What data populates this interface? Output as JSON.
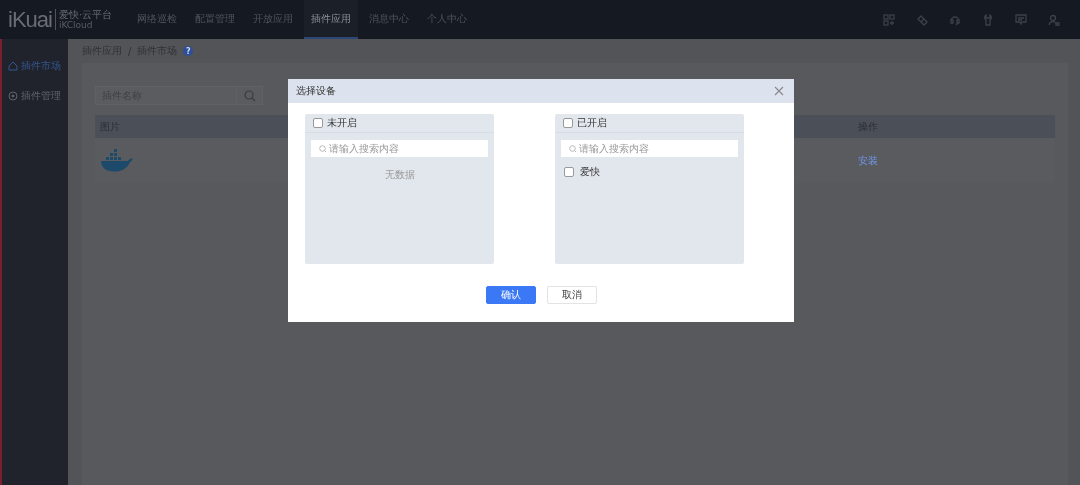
{
  "topbar": {
    "logo": "iKuai",
    "brand_name": "爱快·云平台",
    "brand_sub": "iKCloud",
    "nav": [
      {
        "label": "网络巡检",
        "selected": false
      },
      {
        "label": "配置管理",
        "selected": false
      },
      {
        "label": "开放应用",
        "selected": false
      },
      {
        "label": "插件应用",
        "selected": true
      },
      {
        "label": "消息中心",
        "selected": false
      },
      {
        "label": "个人中心",
        "selected": false
      }
    ]
  },
  "sidebar": {
    "items": [
      {
        "label": "插件市场",
        "selected": true
      },
      {
        "label": "插件管理",
        "selected": false
      }
    ]
  },
  "breadcrumb": {
    "items": [
      "插件应用",
      "插件市场"
    ],
    "separator": "/",
    "help": "?"
  },
  "search": {
    "placeholder": "插件名称"
  },
  "table": {
    "columns": [
      "图片",
      "操作"
    ],
    "rows": [
      {
        "action": "安装"
      }
    ]
  },
  "dialog": {
    "title": "选择设备",
    "lists": [
      {
        "title": "未开启",
        "checked": false,
        "search_placeholder": "请输入搜索内容",
        "empty_text": "无数据"
      },
      {
        "title": "已开启",
        "checked": false,
        "search_placeholder": "请输入搜索内容",
        "items": [
          {
            "label": "爱快",
            "checked": false
          }
        ]
      }
    ],
    "buttons": [
      {
        "label": "确认",
        "kind": "primary"
      },
      {
        "label": "取消",
        "kind": "default"
      }
    ]
  }
}
